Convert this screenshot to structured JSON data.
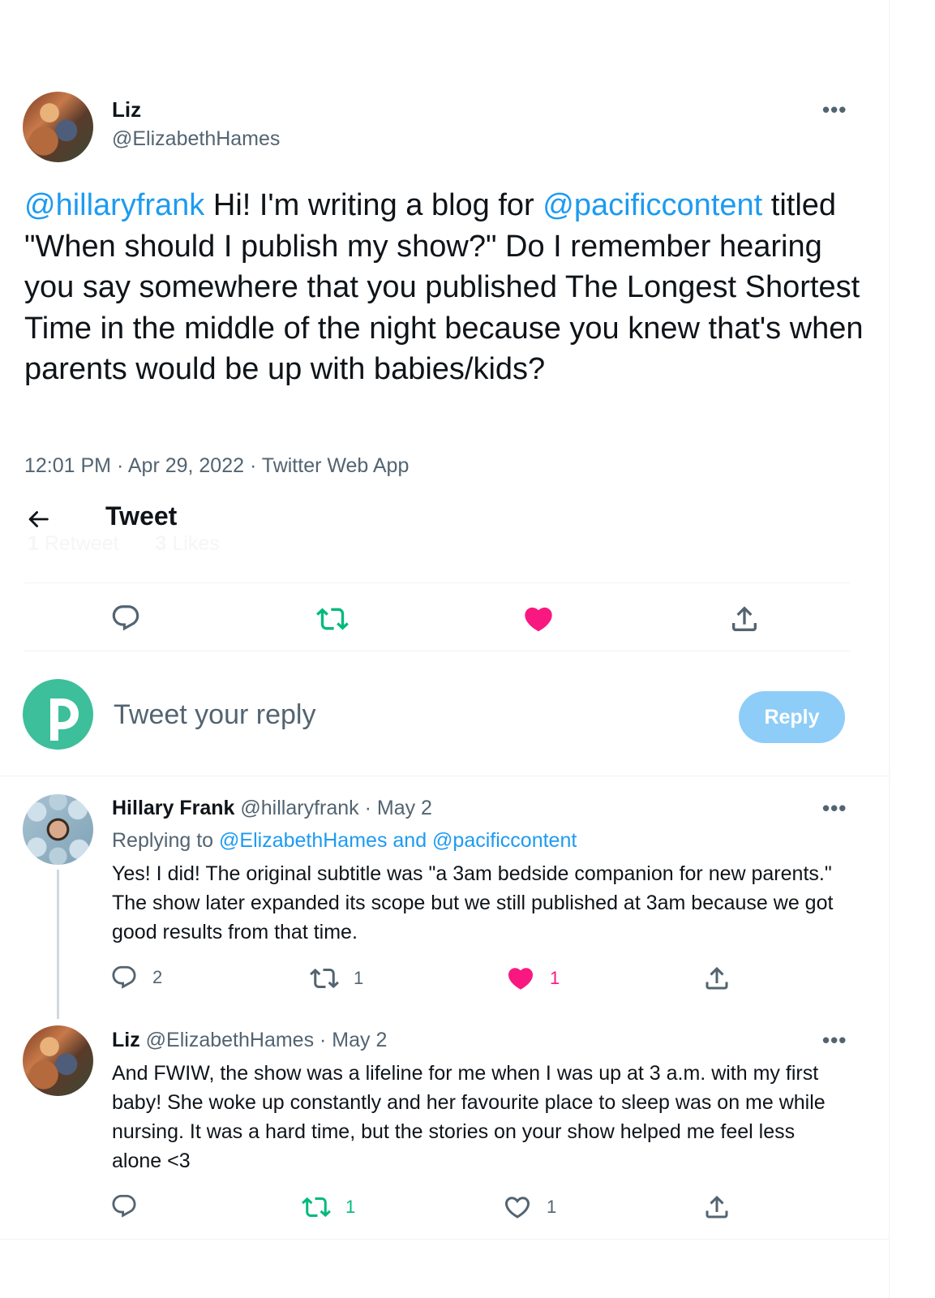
{
  "main_tweet": {
    "author_name": "Liz",
    "author_handle": "@ElizabethHames",
    "more_label": "•••",
    "mention_1": "@hillaryfrank",
    "text_1": " Hi! I'm writing a blog for ",
    "mention_2": "@pacificcontent",
    "text_2": " titled \"When should I publish my show?\" Do I remember hearing you say somewhere that you published The Longest Shortest Time in the middle of the night because you knew that's when parents would be up with babies/kids?",
    "time": "12:01 PM",
    "separator": " · ",
    "date": "Apr 29, 2022",
    "source": "Twitter Web App"
  },
  "header": {
    "back_icon": "arrow-left-icon",
    "title": "Tweet"
  },
  "ghost_stats": {
    "retweet_count": "1",
    "retweet_label": " Retweet",
    "like_count": "3",
    "like_label": " Likes"
  },
  "main_actions": {
    "reply_icon": "reply-icon",
    "retweet_icon": "retweet-icon",
    "like_icon": "heart-filled-icon",
    "share_icon": "share-icon"
  },
  "composer": {
    "placeholder": "Tweet your reply",
    "reply_button": "Reply"
  },
  "replies": [
    {
      "name": "Hillary Frank",
      "handle": " @hillaryfrank",
      "date": " · May 2",
      "replying_prefix": "Replying to ",
      "replying_targets": "@ElizabethHames and @pacificcontent",
      "text": "Yes! I did! The original subtitle was \"a 3am bedside companion for new parents.\" The show later expanded its scope but we still published at 3am because we got good results from that time.",
      "reply_count": "2",
      "retweet_count": "1",
      "like_count": "1"
    },
    {
      "name": "Liz",
      "handle": " @ElizabethHames",
      "date": " · May 2",
      "text": "And FWIW, the show was a lifeline for me when I was up at 3 a.m. with my first baby! She woke up constantly and her favourite place to sleep was on me while nursing.  It was a hard time, but the stories on your show helped me feel less alone <3",
      "retweet_count": "1",
      "like_count": "1"
    }
  ],
  "colors": {
    "accent": "#1d9bf0",
    "retweet_green": "#00ba7c",
    "like_pink": "#f91880",
    "muted": "#536471",
    "reply_button_bg": "#8ecdf8"
  }
}
